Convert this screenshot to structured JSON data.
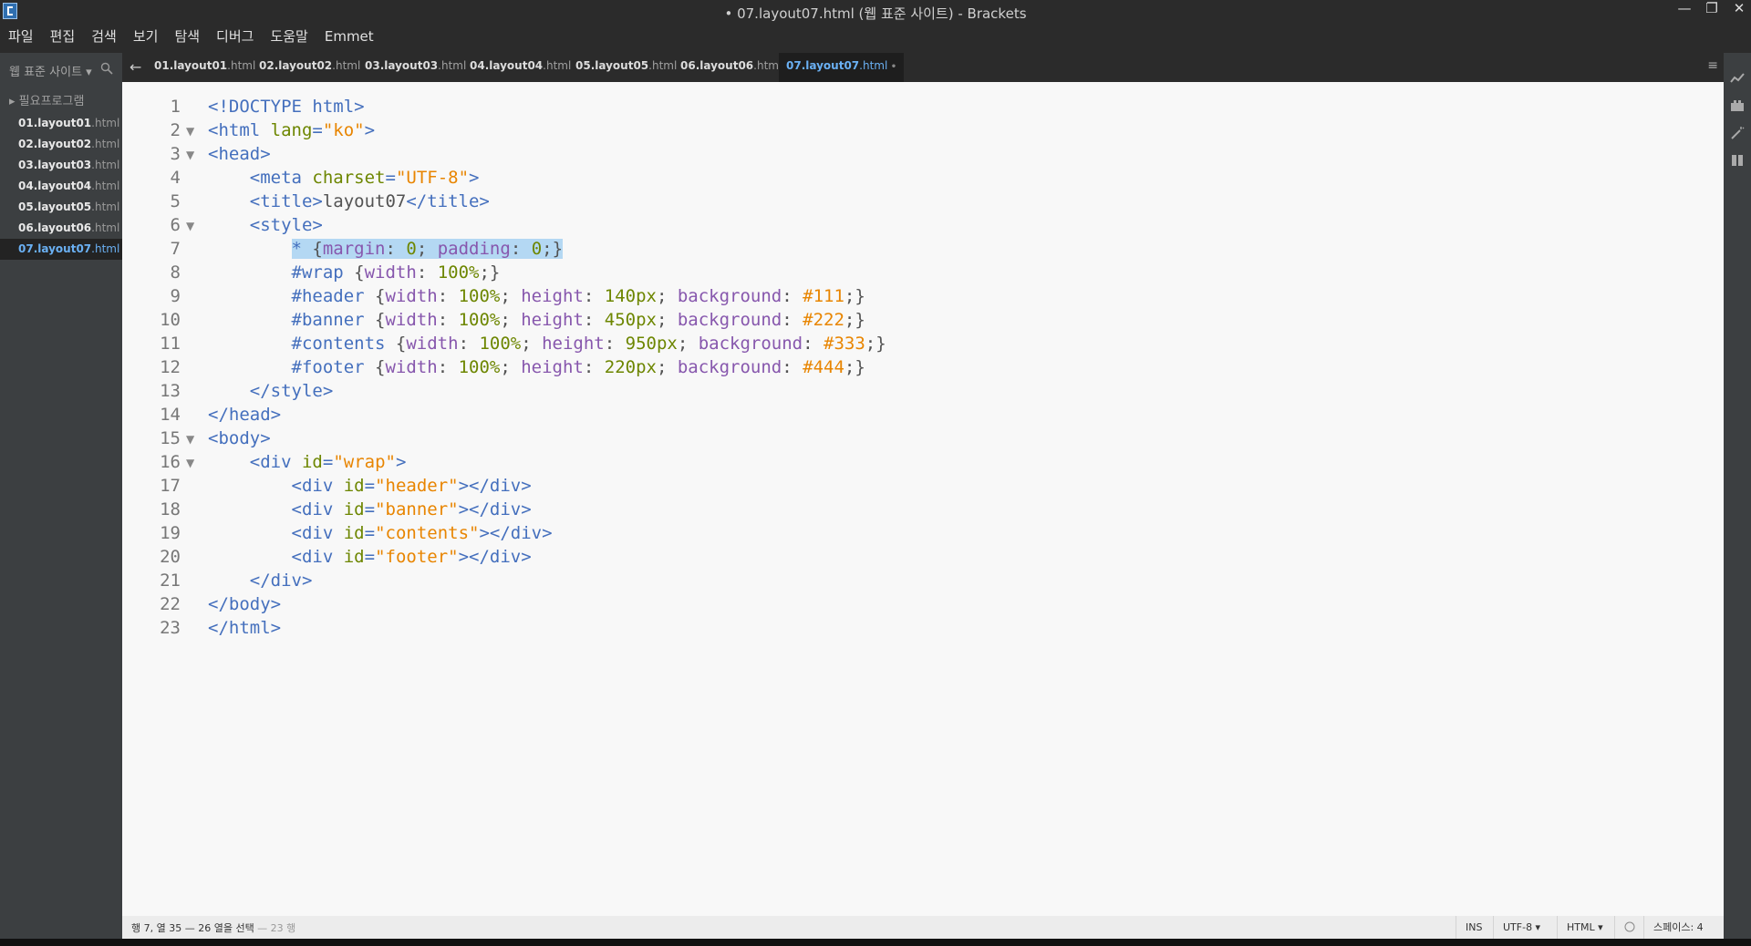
{
  "window": {
    "title": "• 07.layout07.html (웹 표준 사이트) - Brackets",
    "minimize": "—",
    "restore": "❐",
    "close": "✕"
  },
  "menu": [
    "파일",
    "편집",
    "검색",
    "보기",
    "탐색",
    "디버그",
    "도움말",
    "Emmet"
  ],
  "sidebar": {
    "project_title": "웹 표준 사이트 ▾",
    "folder": "▸ 필요프로그램",
    "files": [
      {
        "name": "01.layout01",
        "ext": ".html"
      },
      {
        "name": "02.layout02",
        "ext": ".html"
      },
      {
        "name": "03.layout03",
        "ext": ".html"
      },
      {
        "name": "04.layout04",
        "ext": ".html"
      },
      {
        "name": "05.layout05",
        "ext": ".html"
      },
      {
        "name": "06.layout06",
        "ext": ".html"
      },
      {
        "name": "07.layout07",
        "ext": ".html"
      }
    ],
    "active_index": 6
  },
  "tabs": {
    "back": "←",
    "menu": "≡",
    "items": [
      {
        "name": "01.layout01",
        "ext": ".html"
      },
      {
        "name": "02.layout02",
        "ext": ".html"
      },
      {
        "name": "03.layout03",
        "ext": ".html"
      },
      {
        "name": "04.layout04",
        "ext": ".html"
      },
      {
        "name": "05.layout05",
        "ext": ".html"
      },
      {
        "name": "06.layout06",
        "ext": ".html"
      },
      {
        "name": "07.layout07",
        "ext": ".html"
      }
    ],
    "active_index": 6,
    "dirty_marker": "•"
  },
  "editor": {
    "lines": [
      [
        [
          "tag",
          "<!DOCTYPE html>"
        ]
      ],
      [
        [
          "tag",
          "<html "
        ],
        [
          "attr",
          "lang"
        ],
        [
          "tag",
          "="
        ],
        [
          "str",
          "\"ko\""
        ],
        [
          "tag",
          ">"
        ]
      ],
      [
        [
          "tag",
          "<head>"
        ]
      ],
      [
        [
          "txt",
          "    "
        ],
        [
          "tag",
          "<meta "
        ],
        [
          "attr",
          "charset"
        ],
        [
          "tag",
          "="
        ],
        [
          "str",
          "\"UTF-8\""
        ],
        [
          "tag",
          ">"
        ]
      ],
      [
        [
          "txt",
          "    "
        ],
        [
          "tag",
          "<title>"
        ],
        [
          "txt",
          "layout07"
        ],
        [
          "tag",
          "</title>"
        ]
      ],
      [
        [
          "txt",
          "    "
        ],
        [
          "tag",
          "<style>"
        ]
      ],
      [
        [
          "txt",
          "        "
        ],
        [
          "sel",
          "* "
        ],
        [
          "txt",
          "{"
        ],
        [
          "prop",
          "margin"
        ],
        [
          "txt",
          ": "
        ],
        [
          "num",
          "0"
        ],
        [
          "txt",
          "; "
        ],
        [
          "prop",
          "padding"
        ],
        [
          "txt",
          ": "
        ],
        [
          "num",
          "0"
        ],
        [
          "txt",
          ";}"
        ]
      ],
      [
        [
          "txt",
          "        "
        ],
        [
          "sel",
          "#wrap "
        ],
        [
          "txt",
          "{"
        ],
        [
          "prop",
          "width"
        ],
        [
          "txt",
          ": "
        ],
        [
          "num",
          "100%"
        ],
        [
          "txt",
          ";}"
        ]
      ],
      [
        [
          "txt",
          "        "
        ],
        [
          "sel",
          "#header "
        ],
        [
          "txt",
          "{"
        ],
        [
          "prop",
          "width"
        ],
        [
          "txt",
          ": "
        ],
        [
          "num",
          "100%"
        ],
        [
          "txt",
          "; "
        ],
        [
          "prop",
          "height"
        ],
        [
          "txt",
          ": "
        ],
        [
          "num",
          "140px"
        ],
        [
          "txt",
          "; "
        ],
        [
          "prop",
          "background"
        ],
        [
          "txt",
          ": "
        ],
        [
          "hex",
          "#111"
        ],
        [
          "txt",
          ";}"
        ]
      ],
      [
        [
          "txt",
          "        "
        ],
        [
          "sel",
          "#banner "
        ],
        [
          "txt",
          "{"
        ],
        [
          "prop",
          "width"
        ],
        [
          "txt",
          ": "
        ],
        [
          "num",
          "100%"
        ],
        [
          "txt",
          "; "
        ],
        [
          "prop",
          "height"
        ],
        [
          "txt",
          ": "
        ],
        [
          "num",
          "450px"
        ],
        [
          "txt",
          "; "
        ],
        [
          "prop",
          "background"
        ],
        [
          "txt",
          ": "
        ],
        [
          "hex",
          "#222"
        ],
        [
          "txt",
          ";}"
        ]
      ],
      [
        [
          "txt",
          "        "
        ],
        [
          "sel",
          "#contents "
        ],
        [
          "txt",
          "{"
        ],
        [
          "prop",
          "width"
        ],
        [
          "txt",
          ": "
        ],
        [
          "num",
          "100%"
        ],
        [
          "txt",
          "; "
        ],
        [
          "prop",
          "height"
        ],
        [
          "txt",
          ": "
        ],
        [
          "num",
          "950px"
        ],
        [
          "txt",
          "; "
        ],
        [
          "prop",
          "background"
        ],
        [
          "txt",
          ": "
        ],
        [
          "hex",
          "#333"
        ],
        [
          "txt",
          ";}"
        ]
      ],
      [
        [
          "txt",
          "        "
        ],
        [
          "sel",
          "#footer "
        ],
        [
          "txt",
          "{"
        ],
        [
          "prop",
          "width"
        ],
        [
          "txt",
          ": "
        ],
        [
          "num",
          "100%"
        ],
        [
          "txt",
          "; "
        ],
        [
          "prop",
          "height"
        ],
        [
          "txt",
          ": "
        ],
        [
          "num",
          "220px"
        ],
        [
          "txt",
          "; "
        ],
        [
          "prop",
          "background"
        ],
        [
          "txt",
          ": "
        ],
        [
          "hex",
          "#444"
        ],
        [
          "txt",
          ";}"
        ]
      ],
      [
        [
          "txt",
          "    "
        ],
        [
          "tag",
          "</style>"
        ]
      ],
      [
        [
          "tag",
          "</head>"
        ]
      ],
      [
        [
          "tag",
          "<body>"
        ]
      ],
      [
        [
          "txt",
          "    "
        ],
        [
          "tag",
          "<div "
        ],
        [
          "attr",
          "id"
        ],
        [
          "tag",
          "="
        ],
        [
          "str",
          "\"wrap\""
        ],
        [
          "tag",
          ">"
        ]
      ],
      [
        [
          "txt",
          "        "
        ],
        [
          "tag",
          "<div "
        ],
        [
          "attr",
          "id"
        ],
        [
          "tag",
          "="
        ],
        [
          "str",
          "\"header\""
        ],
        [
          "tag",
          "></div>"
        ]
      ],
      [
        [
          "txt",
          "        "
        ],
        [
          "tag",
          "<div "
        ],
        [
          "attr",
          "id"
        ],
        [
          "tag",
          "="
        ],
        [
          "str",
          "\"banner\""
        ],
        [
          "tag",
          "></div>"
        ]
      ],
      [
        [
          "txt",
          "        "
        ],
        [
          "tag",
          "<div "
        ],
        [
          "attr",
          "id"
        ],
        [
          "tag",
          "="
        ],
        [
          "str",
          "\"contents\""
        ],
        [
          "tag",
          "></div>"
        ]
      ],
      [
        [
          "txt",
          "        "
        ],
        [
          "tag",
          "<div "
        ],
        [
          "attr",
          "id"
        ],
        [
          "tag",
          "="
        ],
        [
          "str",
          "\"footer\""
        ],
        [
          "tag",
          "></div>"
        ]
      ],
      [
        [
          "txt",
          "    "
        ],
        [
          "tag",
          "</div>"
        ]
      ],
      [
        [
          "tag",
          "</body>"
        ]
      ],
      [
        [
          "tag",
          "</html>"
        ]
      ]
    ],
    "fold_lines": [
      2,
      3,
      6,
      15,
      16
    ],
    "highlight_line": 7,
    "fold_marker": "▼"
  },
  "status": {
    "cursor": "행 7, 열 35 — 26 열을 선택",
    "lines": " — 23 행",
    "ins": "INS",
    "encoding": "UTF-8 ▾",
    "language": "HTML ▾",
    "spaces": "스페이스: 4"
  },
  "colors": {
    "editor_bg": "#f8f8f8",
    "sidebar_bg": "#3c3f41",
    "active_blue": "#6ab0f3",
    "selection": "#b4d8f3"
  }
}
